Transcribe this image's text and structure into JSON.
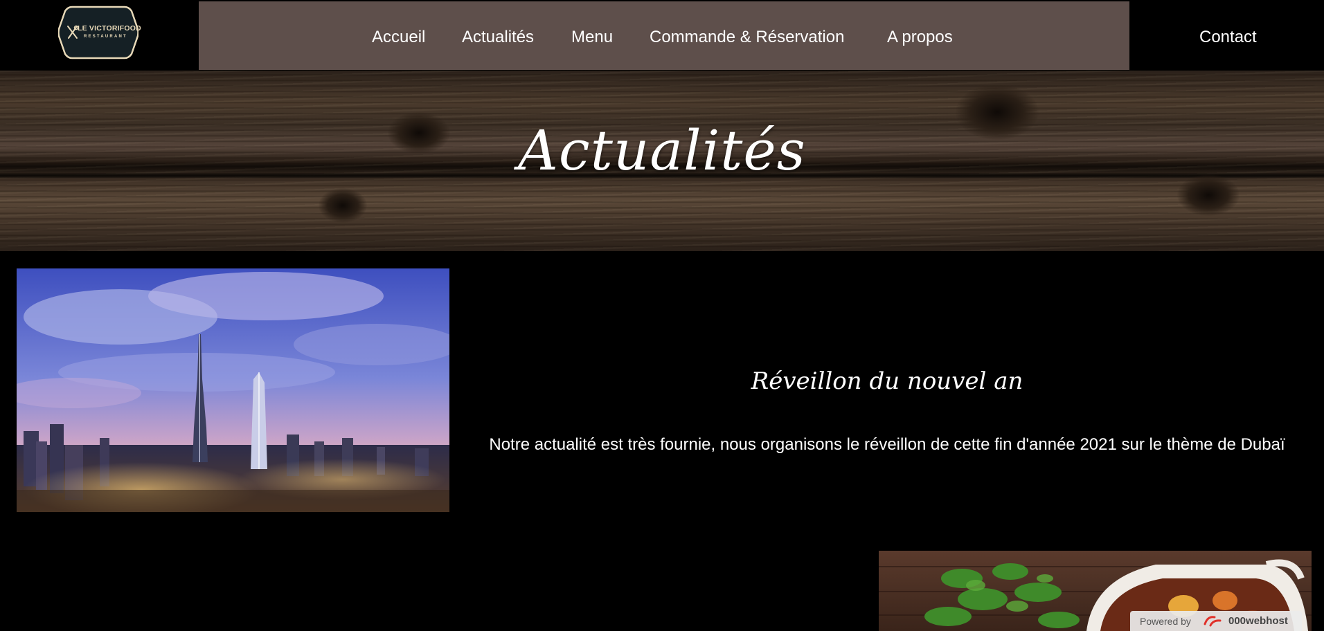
{
  "header": {
    "logo": {
      "name": "LE VICTORIFOOD",
      "subtitle": "RESTAURANT",
      "icon": "cutlery-icon"
    },
    "nav": [
      {
        "label": "Accueil"
      },
      {
        "label": "Actualités"
      },
      {
        "label": "Menu"
      },
      {
        "label": "Commande & Réservation"
      },
      {
        "label": "A propos"
      }
    ],
    "contact_label": "Contact"
  },
  "banner": {
    "title": "Actualités"
  },
  "articles": [
    {
      "title": "Réveillon du nouvel an",
      "text": "Notre actualité est très fournie, nous organisons le réveillon de cette fin d'année 2021 sur le thème de Dubaï"
    }
  ],
  "footer_badge": {
    "prefix": "Powered by",
    "brand": "000webhost"
  },
  "colors": {
    "background": "#000000",
    "nav_bar": "#5e4f4b",
    "text": "#ffffff",
    "logo_accent": "#e8d9b8"
  }
}
